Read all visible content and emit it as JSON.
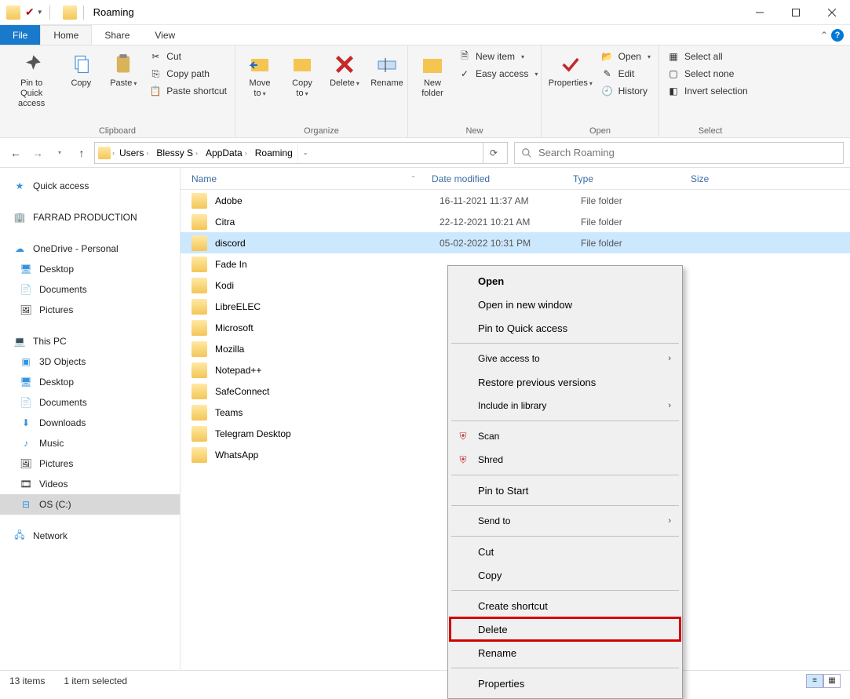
{
  "title": "Roaming",
  "tabs": {
    "file": "File",
    "home": "Home",
    "share": "Share",
    "view": "View"
  },
  "ribbon": {
    "clipboard": {
      "label": "Clipboard",
      "pin": "Pin to Quick\naccess",
      "copy": "Copy",
      "paste": "Paste",
      "cut": "Cut",
      "copypath": "Copy path",
      "pastesc": "Paste shortcut"
    },
    "organize": {
      "label": "Organize",
      "moveto": "Move\nto",
      "copyto": "Copy\nto",
      "delete": "Delete",
      "rename": "Rename"
    },
    "new": {
      "label": "New",
      "newfolder": "New\nfolder",
      "newitem": "New item",
      "easy": "Easy access"
    },
    "open": {
      "label": "Open",
      "properties": "Properties",
      "open": "Open",
      "edit": "Edit",
      "history": "History"
    },
    "select": {
      "label": "Select",
      "all": "Select all",
      "none": "Select none",
      "invert": "Invert selection"
    }
  },
  "breadcrumbs": [
    "Users",
    "Blessy S",
    "AppData",
    "Roaming"
  ],
  "search_placeholder": "Search Roaming",
  "sidebar": {
    "quick": "Quick access",
    "farrad": "FARRAD PRODUCTION",
    "onedrive": "OneDrive - Personal",
    "od_items": [
      "Desktop",
      "Documents",
      "Pictures"
    ],
    "thispc": "This PC",
    "pc_items": [
      "3D Objects",
      "Desktop",
      "Documents",
      "Downloads",
      "Music",
      "Pictures",
      "Videos",
      "OS (C:)"
    ],
    "network": "Network"
  },
  "columns": {
    "name": "Name",
    "date": "Date modified",
    "type": "Type",
    "size": "Size"
  },
  "rows": [
    {
      "name": "Adobe",
      "date": "16-11-2021 11:37 AM",
      "type": "File folder",
      "sel": false
    },
    {
      "name": "Citra",
      "date": "22-12-2021 10:21 AM",
      "type": "File folder",
      "sel": false
    },
    {
      "name": "discord",
      "date": "05-02-2022 10:31 PM",
      "type": "File folder",
      "sel": true
    },
    {
      "name": "Fade In",
      "date": "",
      "type": "",
      "sel": false
    },
    {
      "name": "Kodi",
      "date": "",
      "type": "",
      "sel": false
    },
    {
      "name": "LibreELEC",
      "date": "",
      "type": "",
      "sel": false
    },
    {
      "name": "Microsoft",
      "date": "",
      "type": "",
      "sel": false
    },
    {
      "name": "Mozilla",
      "date": "",
      "type": "",
      "sel": false
    },
    {
      "name": "Notepad++",
      "date": "",
      "type": "",
      "sel": false
    },
    {
      "name": "SafeConnect",
      "date": "",
      "type": "",
      "sel": false
    },
    {
      "name": "Teams",
      "date": "",
      "type": "",
      "sel": false
    },
    {
      "name": "Telegram Desktop",
      "date": "",
      "type": "",
      "sel": false
    },
    {
      "name": "WhatsApp",
      "date": "",
      "type": "",
      "sel": false
    }
  ],
  "context_menu": {
    "open": "Open",
    "open_new": "Open in new window",
    "pin_qa": "Pin to Quick access",
    "give": "Give access to",
    "restore": "Restore previous versions",
    "include": "Include in library",
    "scan": "Scan",
    "shred": "Shred",
    "pin_start": "Pin to Start",
    "sendto": "Send to",
    "cut": "Cut",
    "copy": "Copy",
    "create_sc": "Create shortcut",
    "delete": "Delete",
    "rename": "Rename",
    "properties": "Properties"
  },
  "status": {
    "count": "13 items",
    "selected": "1 item selected"
  }
}
